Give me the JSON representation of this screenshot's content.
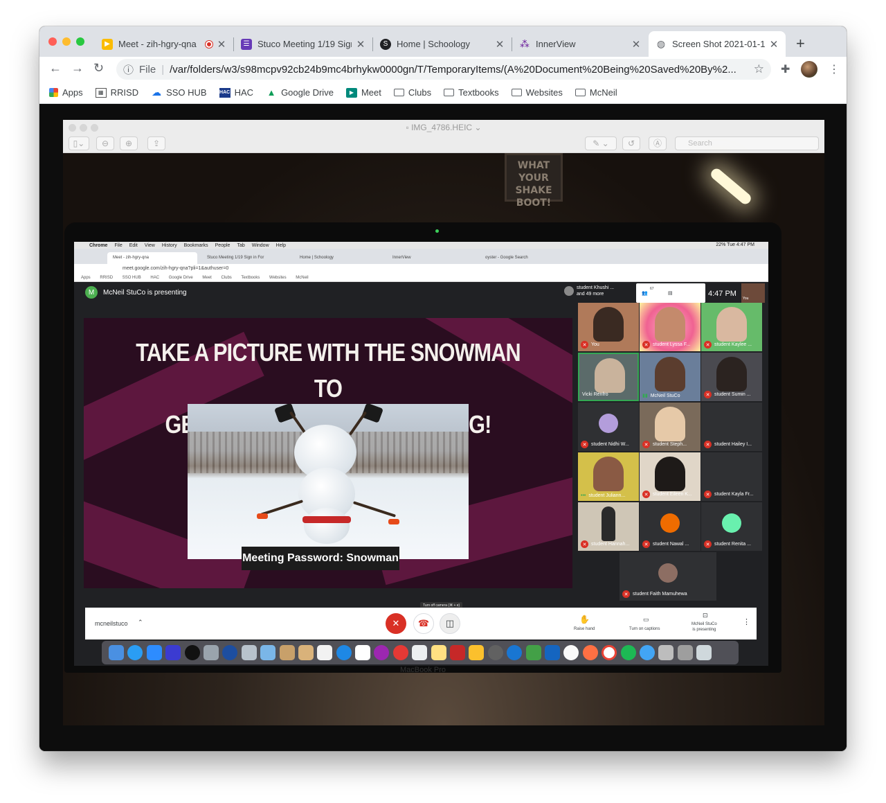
{
  "browser": {
    "tabs": [
      {
        "title": "Meet - zih-hgry-qna",
        "favicon": "google-meet-icon",
        "recording": true
      },
      {
        "title": "Stuco Meeting 1/19 Sign",
        "favicon": "google-forms-icon"
      },
      {
        "title": "Home | Schoology",
        "favicon": "schoology-icon"
      },
      {
        "title": "InnerView",
        "favicon": "innerview-icon"
      },
      {
        "title": "Screen Shot 2021-01-1",
        "favicon": "globe-icon",
        "active": true
      }
    ],
    "close_glyph": "✕",
    "new_tab_glyph": "+",
    "address": {
      "info_glyph": "ⓘ",
      "scheme_label": "File",
      "url": "/var/folders/w3/s98mcpv92cb24b9mc4brhykw0000gn/T/TemporaryItems/(A%20Document%20Being%20Saved%20By%2..."
    },
    "bookmarks": [
      {
        "label": "Apps",
        "icon": "apps-grid-icon"
      },
      {
        "label": "RRISD",
        "icon": "rrisd-icon"
      },
      {
        "label": "SSO HUB",
        "icon": "cloud-icon"
      },
      {
        "label": "HAC",
        "icon": "hac-icon"
      },
      {
        "label": "Google Drive",
        "icon": "google-drive-icon"
      },
      {
        "label": "Meet",
        "icon": "google-meet-icon"
      },
      {
        "label": "Clubs",
        "icon": "folder-icon"
      },
      {
        "label": "Textbooks",
        "icon": "folder-icon"
      },
      {
        "label": "Websites",
        "icon": "folder-icon"
      },
      {
        "label": "McNeil",
        "icon": "folder-icon"
      }
    ]
  },
  "preview": {
    "filename": "IMG_4786.HEIC",
    "search_placeholder": "Search"
  },
  "photo": {
    "poster_text": "WHAT YOUR SHAKE BOOT!",
    "inner_menubar": {
      "items": [
        "Chrome",
        "File",
        "Edit",
        "View",
        "History",
        "Bookmarks",
        "People",
        "Tab",
        "Window",
        "Help"
      ],
      "right": "22%   Tue 4:47 PM"
    },
    "inner_tabs": [
      "Meet - zih-hgry-qna",
      "Stuco Meeting 1/19 Sign in For",
      "Home | Schoology",
      "InnerView",
      "oyster - Google Search"
    ],
    "inner_url": "meet.google.com/zih-hgry-qna?pli=1&authuser=0",
    "inner_bookmarks": [
      "Apps",
      "RRISD",
      "SSO HUB",
      "HAC",
      "Google Drive",
      "Meet",
      "Clubs",
      "Textbooks",
      "Websites",
      "McNeil"
    ],
    "meet": {
      "presenter_initial": "M",
      "presenting_label": "McNeil StuCo is presenting",
      "participants_summary": "student Khushi ...\nand 49 more",
      "participant_count": "67",
      "time": "4:47 PM",
      "self_label": "You",
      "slide": {
        "title_line1": "Take a picture with the snowman to",
        "title_line2": "get credit for this meeting!",
        "password": "Meeting Password: Snowman"
      },
      "tiles": [
        {
          "name": "You",
          "muted": true
        },
        {
          "name": "student Lyssa F...",
          "muted": true
        },
        {
          "name": "student Kaylee ...",
          "muted": true
        },
        {
          "name": "Vicki Renfro",
          "muted": false
        },
        {
          "name": "McNeil StuCo",
          "muted": false
        },
        {
          "name": "student Sumin ...",
          "muted": true
        },
        {
          "name": "student Nidhi W...",
          "muted": true
        },
        {
          "name": "student Steph...",
          "muted": true
        },
        {
          "name": "student Hailey I...",
          "muted": true
        },
        {
          "name": "student Juliann...",
          "muted": false
        },
        {
          "name": "student Eileen K...",
          "muted": true
        },
        {
          "name": "student Kayla Fr...",
          "muted": true
        },
        {
          "name": "student Hannah...",
          "muted": true
        },
        {
          "name": "student Nawal ...",
          "muted": true
        },
        {
          "name": "student Renita ...",
          "muted": true
        },
        {
          "name": "student Faith Mamuhewa",
          "muted": true
        }
      ],
      "controls": {
        "meeting_code": "mcneilstuco",
        "tooltip": "Turn off camera (⌘ + e)",
        "raise_hand": "Raise hand",
        "captions": "Turn on captions",
        "presenting": "McNeil StuCo\nis presenting"
      }
    },
    "laptop_label": "MacBook Pro"
  },
  "colors": {
    "meet_red": "#d93025",
    "slide_bg": "#2a0d20",
    "tab_strip": "#dee1e6"
  }
}
